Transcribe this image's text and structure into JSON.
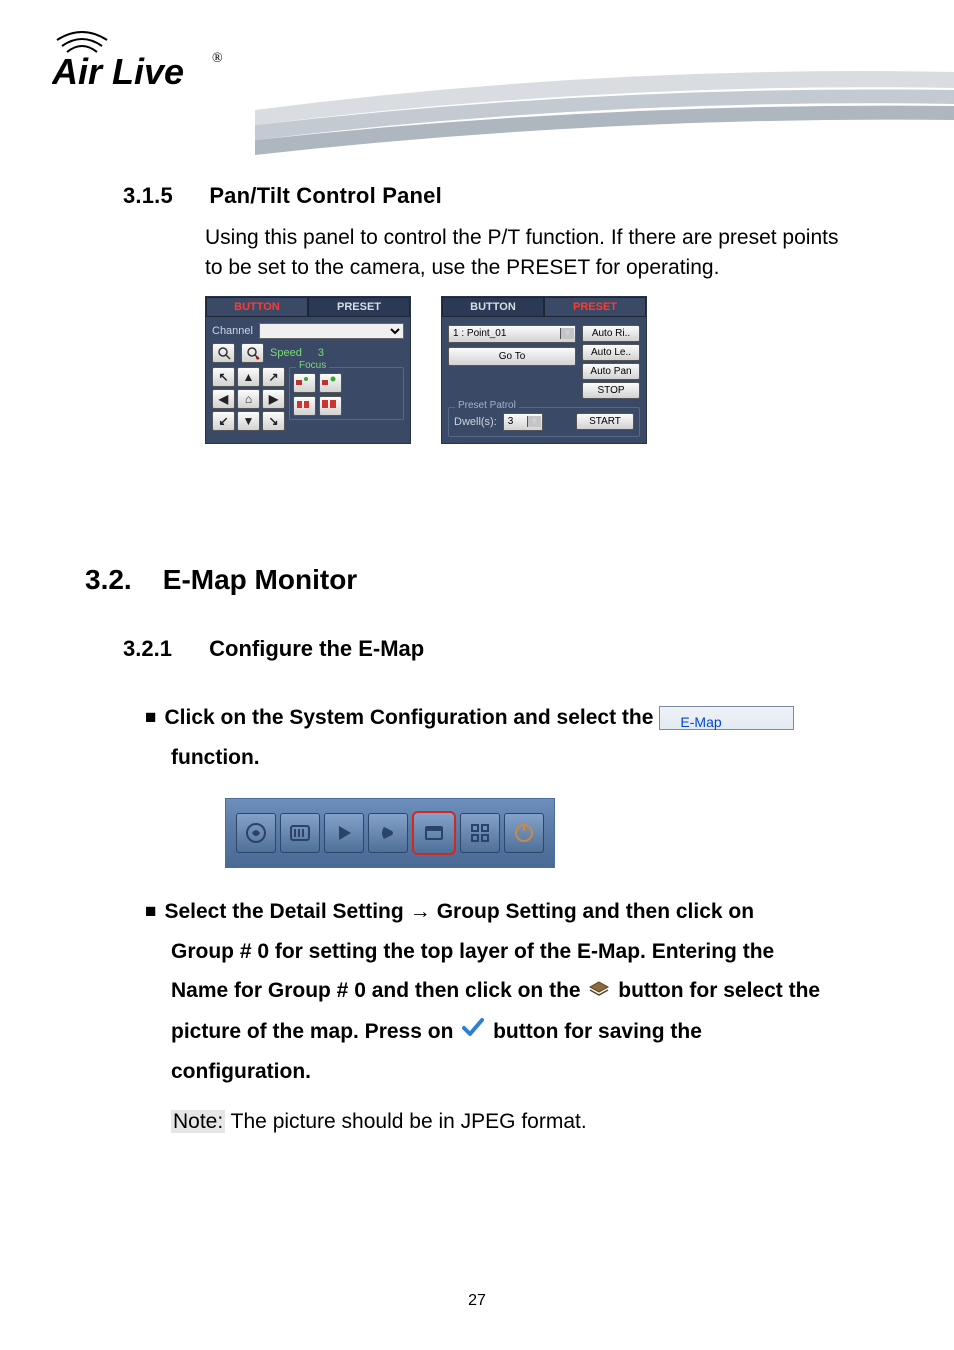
{
  "logo": {
    "brand": "Air Live",
    "reg": "®"
  },
  "section_315": {
    "num": "3.1.5",
    "title": "Pan/Tilt Control Panel",
    "paragraph": "Using this panel to control the P/T function. If there are preset points to be set to the camera, use the PRESET for operating."
  },
  "panel1": {
    "tab_a": "BUTTON",
    "tab_b": "PRESET",
    "channel_label": "Channel",
    "speed_label": "Speed",
    "speed_value": "3",
    "focus_label": "Focus"
  },
  "panel2": {
    "tab_a": "BUTTON",
    "tab_b": "PRESET",
    "preset_sel": "1 : Point_01",
    "goto": "Go To",
    "auto_ri": "Auto Ri..",
    "auto_le": "Auto Le..",
    "auto_pan": "Auto Pan",
    "stop": "STOP",
    "patrol_label": "Preset Patrol",
    "dwell_label": "Dwell(s):",
    "dwell_value": "3",
    "start": "START"
  },
  "section_32": {
    "num": "3.2.",
    "title": "E-Map Monitor"
  },
  "section_321": {
    "num": "3.2.1",
    "title": "Configure the E-Map"
  },
  "bullet1": {
    "pre": "Click on the System Configuration and select the",
    "badge": "E-Map",
    "post": "function."
  },
  "bullet2": {
    "l1_pre": "Select the Detail Setting",
    "arrow": "→",
    "l1_post": "Group Setting and then click on",
    "l2": "Group # 0 for setting the top layer of the E-Map. Entering the",
    "l3_pre": "Name for Group # 0 and then click on the",
    "l3_post": "button for select the",
    "l4_pre": "picture of the map. Press on",
    "l4_post": "button for saving the",
    "l5": "configuration."
  },
  "note": {
    "label": "Note:",
    "text": "The picture should be in JPEG format."
  },
  "page_number": "27"
}
